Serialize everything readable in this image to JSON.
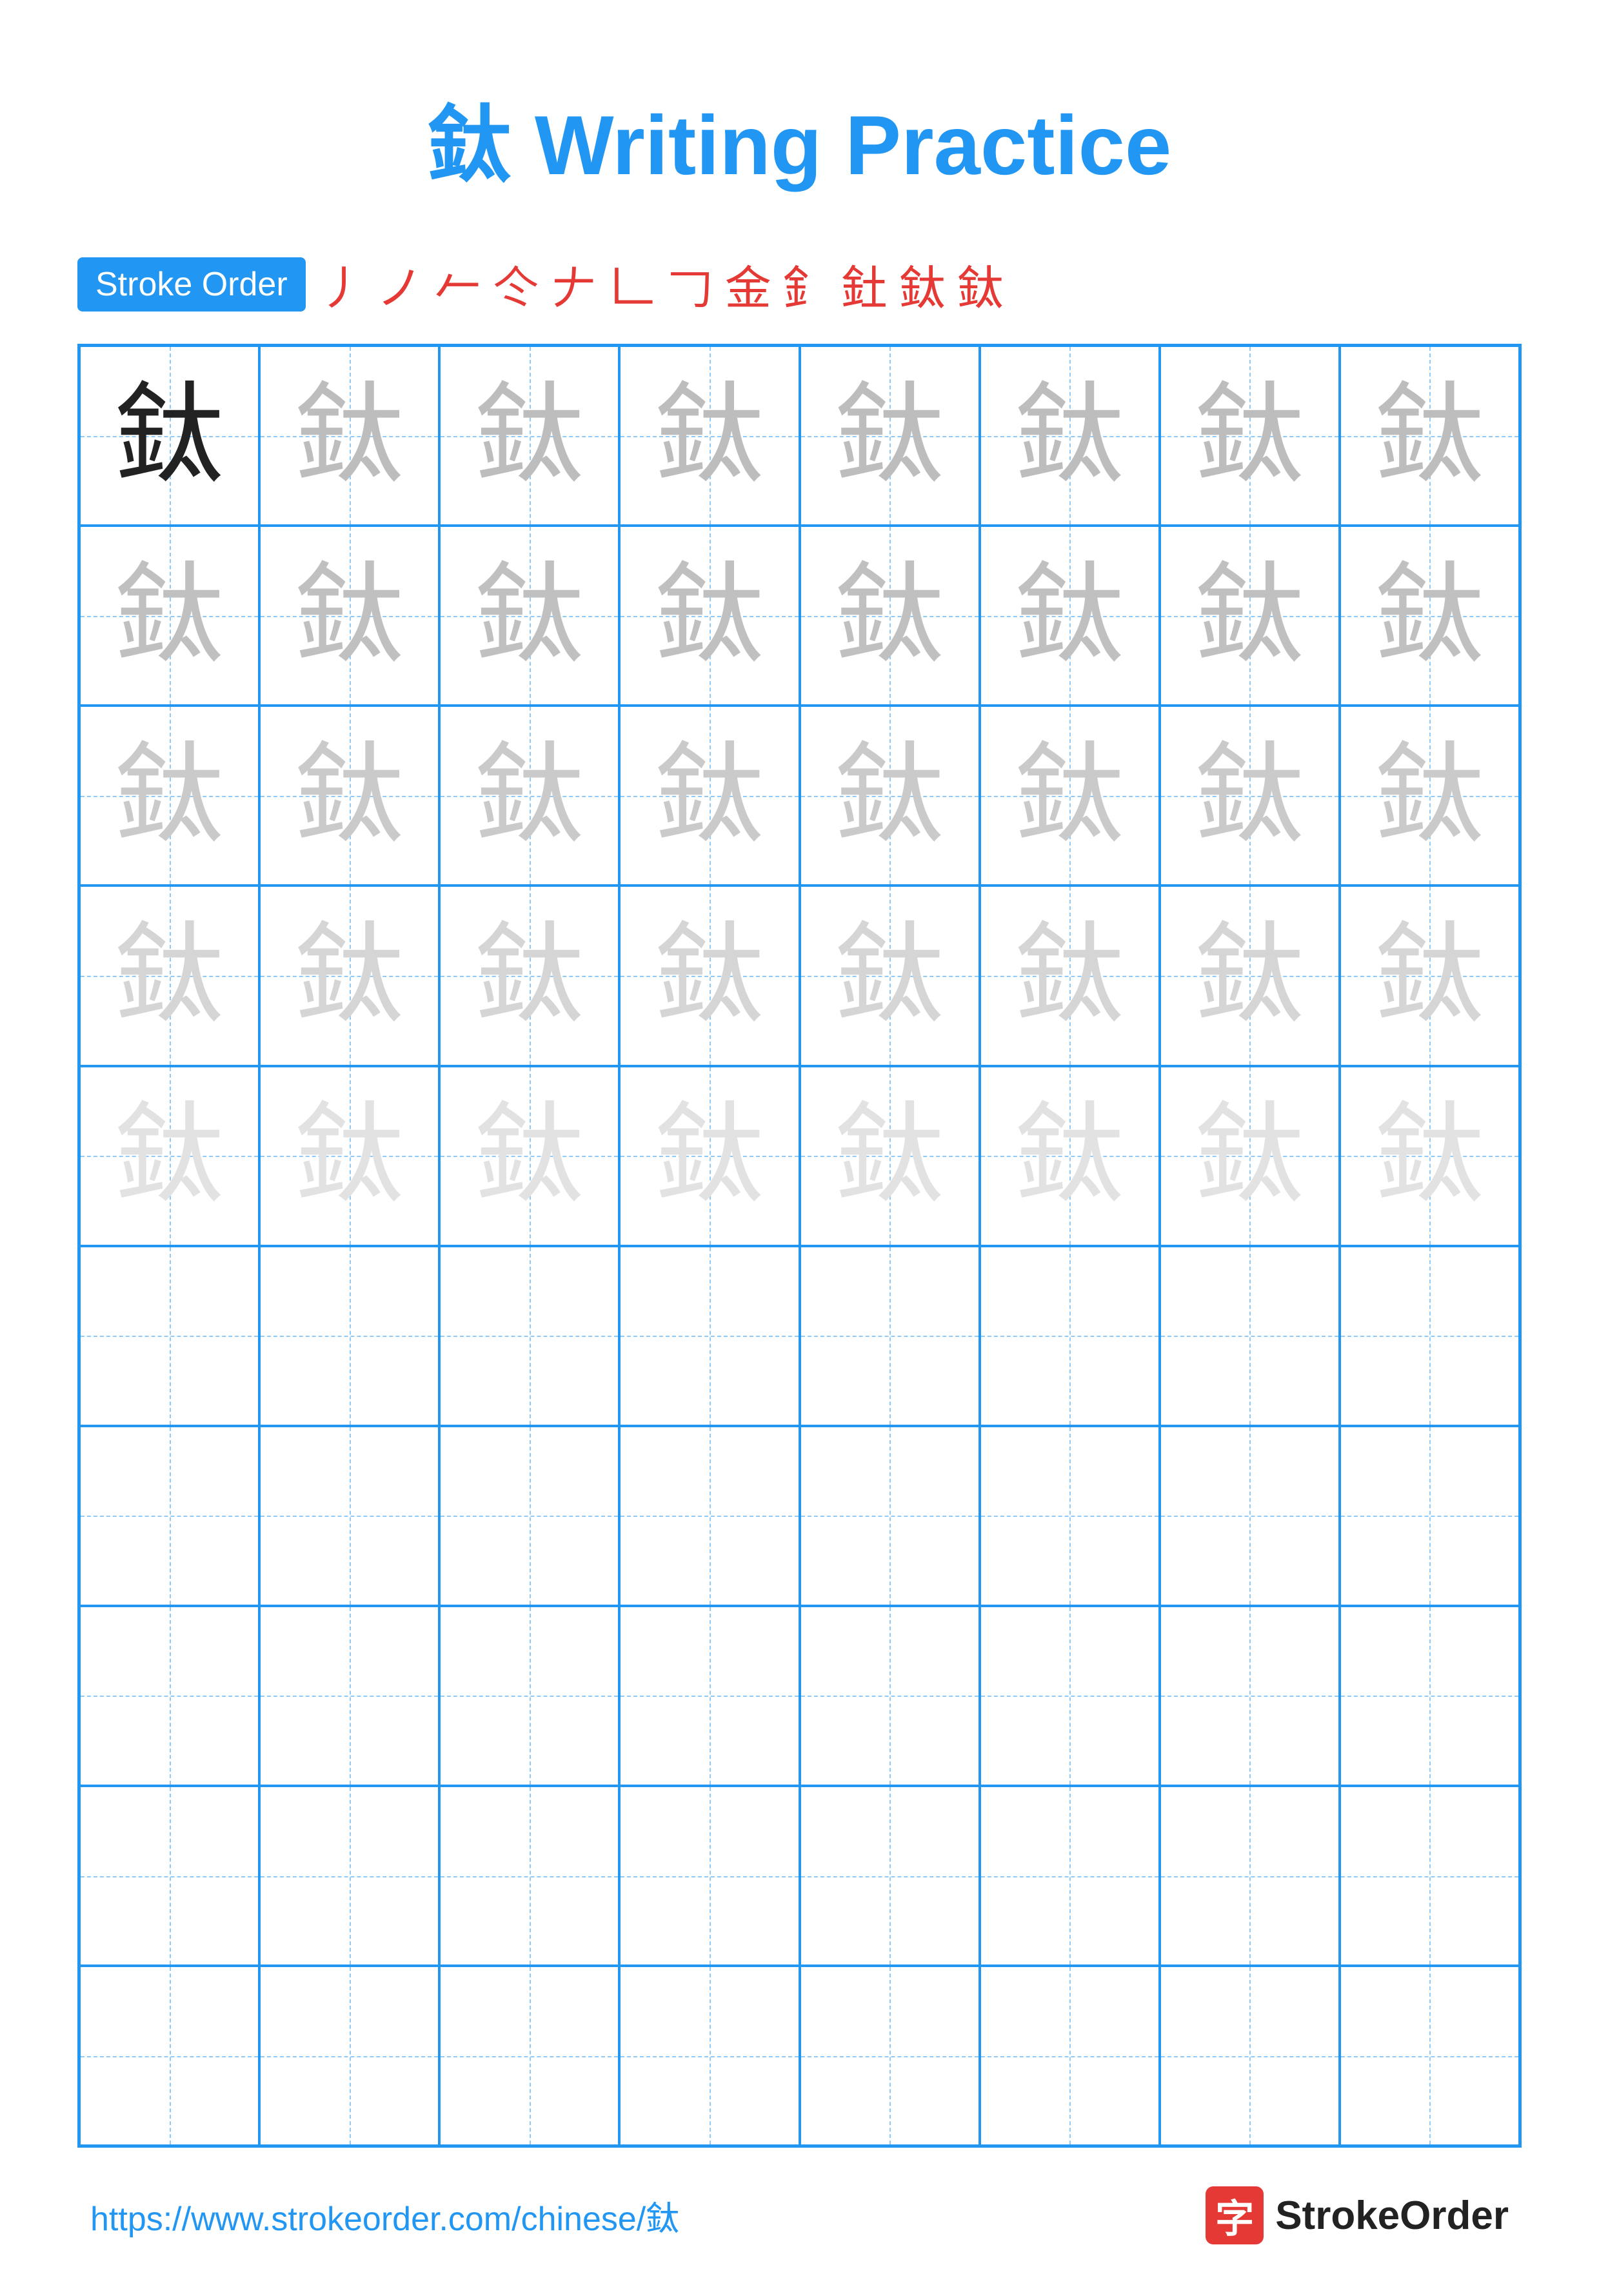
{
  "title": "鈦 Writing Practice",
  "stroke_order": {
    "badge_label": "Stroke Order",
    "strokes": [
      "丿",
      "ノ",
      "𠂉",
      "仒",
      "𠂇",
      "𠃊",
      "𠃌",
      "金",
      "釒",
      "釷",
      "鈦",
      "鈦"
    ]
  },
  "character": "鈦",
  "grid": {
    "rows": 10,
    "cols": 8
  },
  "footer": {
    "url": "https://www.strokeorder.com/chinese/鈦",
    "logo_char": "字",
    "logo_text": "StrokeOrder"
  }
}
